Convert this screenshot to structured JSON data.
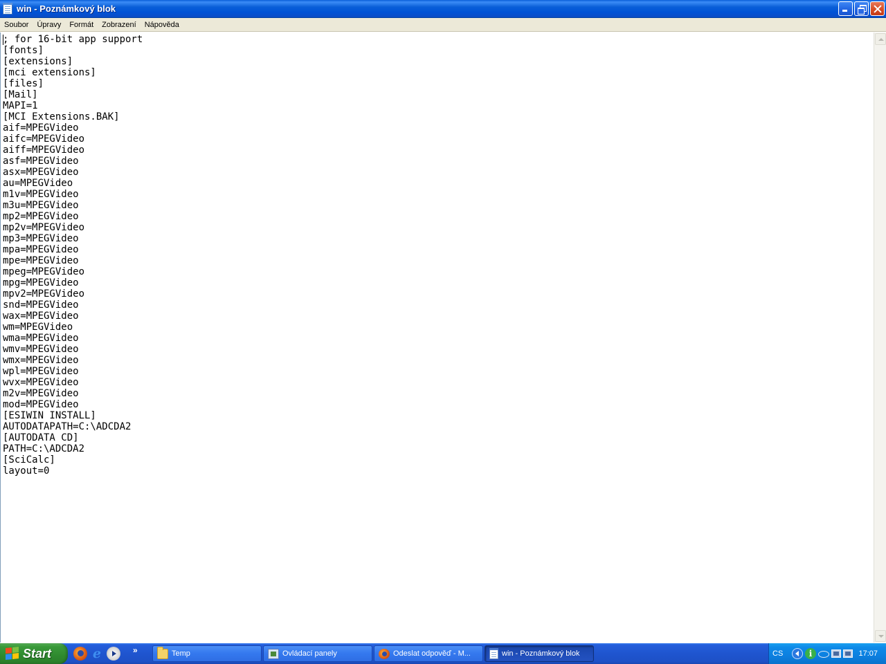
{
  "window": {
    "title": "win - Poznámkový blok"
  },
  "menu": {
    "items": [
      {
        "label": "Soubor"
      },
      {
        "label": "Úpravy"
      },
      {
        "label": "Formát"
      },
      {
        "label": "Zobrazení"
      },
      {
        "label": "Nápověda"
      }
    ]
  },
  "document": {
    "lines": [
      "; for 16-bit app support",
      "[fonts]",
      "[extensions]",
      "[mci extensions]",
      "[files]",
      "[Mail]",
      "MAPI=1",
      "[MCI Extensions.BAK]",
      "aif=MPEGVideo",
      "aifc=MPEGVideo",
      "aiff=MPEGVideo",
      "asf=MPEGVideo",
      "asx=MPEGVideo",
      "au=MPEGVideo",
      "m1v=MPEGVideo",
      "m3u=MPEGVideo",
      "mp2=MPEGVideo",
      "mp2v=MPEGVideo",
      "mp3=MPEGVideo",
      "mpa=MPEGVideo",
      "mpe=MPEGVideo",
      "mpeg=MPEGVideo",
      "mpg=MPEGVideo",
      "mpv2=MPEGVideo",
      "snd=MPEGVideo",
      "wax=MPEGVideo",
      "wm=MPEGVideo",
      "wma=MPEGVideo",
      "wmv=MPEGVideo",
      "wmx=MPEGVideo",
      "wpl=MPEGVideo",
      "wvx=MPEGVideo",
      "m2v=MPEGVideo",
      "mod=MPEGVideo",
      "[ESIWIN INSTALL]",
      "AUTODATAPATH=C:\\ADCDA2",
      "[AUTODATA CD]",
      "PATH=C:\\ADCDA2",
      "[SciCalc]",
      "layout=0"
    ]
  },
  "taskbar": {
    "start_label": "Start",
    "quick_launch": [
      {
        "icon": "firefox-icon"
      },
      {
        "icon": "internet-explorer-icon"
      },
      {
        "icon": "media-player-icon"
      }
    ],
    "more_label": "»",
    "tasks": [
      {
        "label": "Temp",
        "icon": "folder-icon",
        "active": false
      },
      {
        "label": "Ovládací panely",
        "icon": "control-panel-icon",
        "active": false
      },
      {
        "label": "Odeslat odpověď - M...",
        "icon": "firefox-icon",
        "active": false
      },
      {
        "label": "win - Poznámkový blok",
        "icon": "notepad-icon",
        "active": true
      }
    ],
    "tray": {
      "language": "CS",
      "clock": "17:07"
    }
  },
  "colors": {
    "titlebar_blue": "#0a5fd8",
    "menubar_bg": "#ece9d8",
    "taskbar_blue": "#245edb",
    "start_green": "#3a9a3a",
    "tray_blue": "#0c80e0"
  }
}
